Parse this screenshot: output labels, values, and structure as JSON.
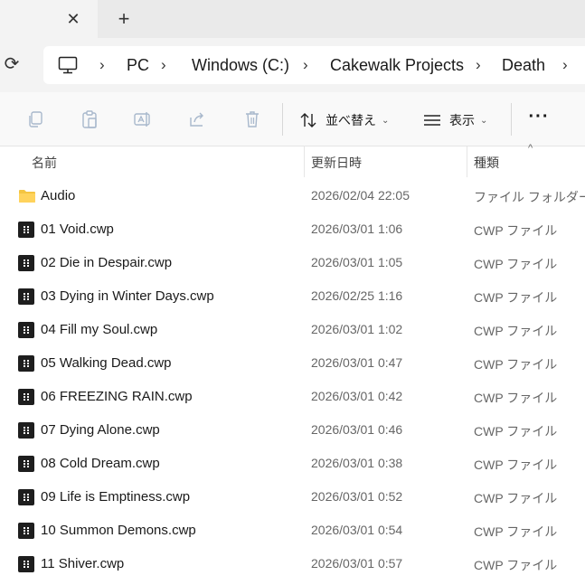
{
  "tabs": {
    "close_glyph": "✕",
    "new_tab_glyph": "+"
  },
  "address": {
    "refresh_glyph": "⟳",
    "crumbs": [
      "PC",
      "Windows (C:)",
      "Cakewalk Projects",
      "Death"
    ],
    "separator": "›"
  },
  "toolbar": {
    "icons": [
      "copy-icon",
      "paste-icon",
      "rename-icon",
      "share-icon",
      "delete-icon"
    ],
    "sort_label": "並べ替え",
    "view_label": "表示",
    "more_label": "···"
  },
  "columns": {
    "name": "名前",
    "date": "更新日時",
    "type": "種類"
  },
  "files": [
    {
      "name": "Audio",
      "date": "2026/02/04 22:05",
      "type": "ファイル フォルダー",
      "icon": "folder-icon"
    },
    {
      "name": "01 Void.cwp",
      "date": "2026/03/01 1:06",
      "type": "CWP ファイル",
      "icon": "cwp-file-icon"
    },
    {
      "name": "02 Die in Despair.cwp",
      "date": "2026/03/01 1:05",
      "type": "CWP ファイル",
      "icon": "cwp-file-icon"
    },
    {
      "name": "03 Dying in Winter Days.cwp",
      "date": "2026/02/25 1:16",
      "type": "CWP ファイル",
      "icon": "cwp-file-icon"
    },
    {
      "name": "04 Fill my Soul.cwp",
      "date": "2026/03/01 1:02",
      "type": "CWP ファイル",
      "icon": "cwp-file-icon"
    },
    {
      "name": "05 Walking Dead.cwp",
      "date": "2026/03/01 0:47",
      "type": "CWP ファイル",
      "icon": "cwp-file-icon"
    },
    {
      "name": "06 FREEZING RAIN.cwp",
      "date": "2026/03/01 0:42",
      "type": "CWP ファイル",
      "icon": "cwp-file-icon"
    },
    {
      "name": "07 Dying Alone.cwp",
      "date": "2026/03/01 0:46",
      "type": "CWP ファイル",
      "icon": "cwp-file-icon"
    },
    {
      "name": "08 Cold Dream.cwp",
      "date": "2026/03/01 0:38",
      "type": "CWP ファイル",
      "icon": "cwp-file-icon"
    },
    {
      "name": "09 Life is Emptiness.cwp",
      "date": "2026/03/01 0:52",
      "type": "CWP ファイル",
      "icon": "cwp-file-icon"
    },
    {
      "name": "10 Summon Demons.cwp",
      "date": "2026/03/01 0:54",
      "type": "CWP ファイル",
      "icon": "cwp-file-icon"
    },
    {
      "name": "11 Shiver.cwp",
      "date": "2026/03/01 0:57",
      "type": "CWP ファイル",
      "icon": "cwp-file-icon"
    }
  ],
  "colors": {
    "folder": "#f4c542",
    "cwp_icon": "#1e1e1e",
    "addressbar_bg": "#f3f3f3"
  }
}
